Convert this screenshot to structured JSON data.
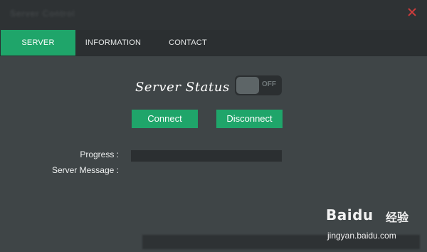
{
  "window": {
    "title": "Server Control"
  },
  "tabs": [
    {
      "label": "SERVER",
      "active": true
    },
    {
      "label": "INFORMATION",
      "active": false
    },
    {
      "label": "CONTACT",
      "active": false
    }
  ],
  "server": {
    "status_label": "Server Status :",
    "toggle": {
      "state_text": "OFF",
      "is_on": false
    },
    "connect_label": "Connect",
    "disconnect_label": "Disconnect",
    "progress_label": "Progress :",
    "progress_value": 0,
    "message_label": "Server Message :",
    "message_value": ""
  },
  "watermark": {
    "logo": "Baidu",
    "chinese": "经验",
    "url": "jingyan.baidu.com"
  },
  "colors": {
    "accent": "#1fa56a",
    "background": "#3f4547",
    "toolbar": "#2b2f31"
  }
}
